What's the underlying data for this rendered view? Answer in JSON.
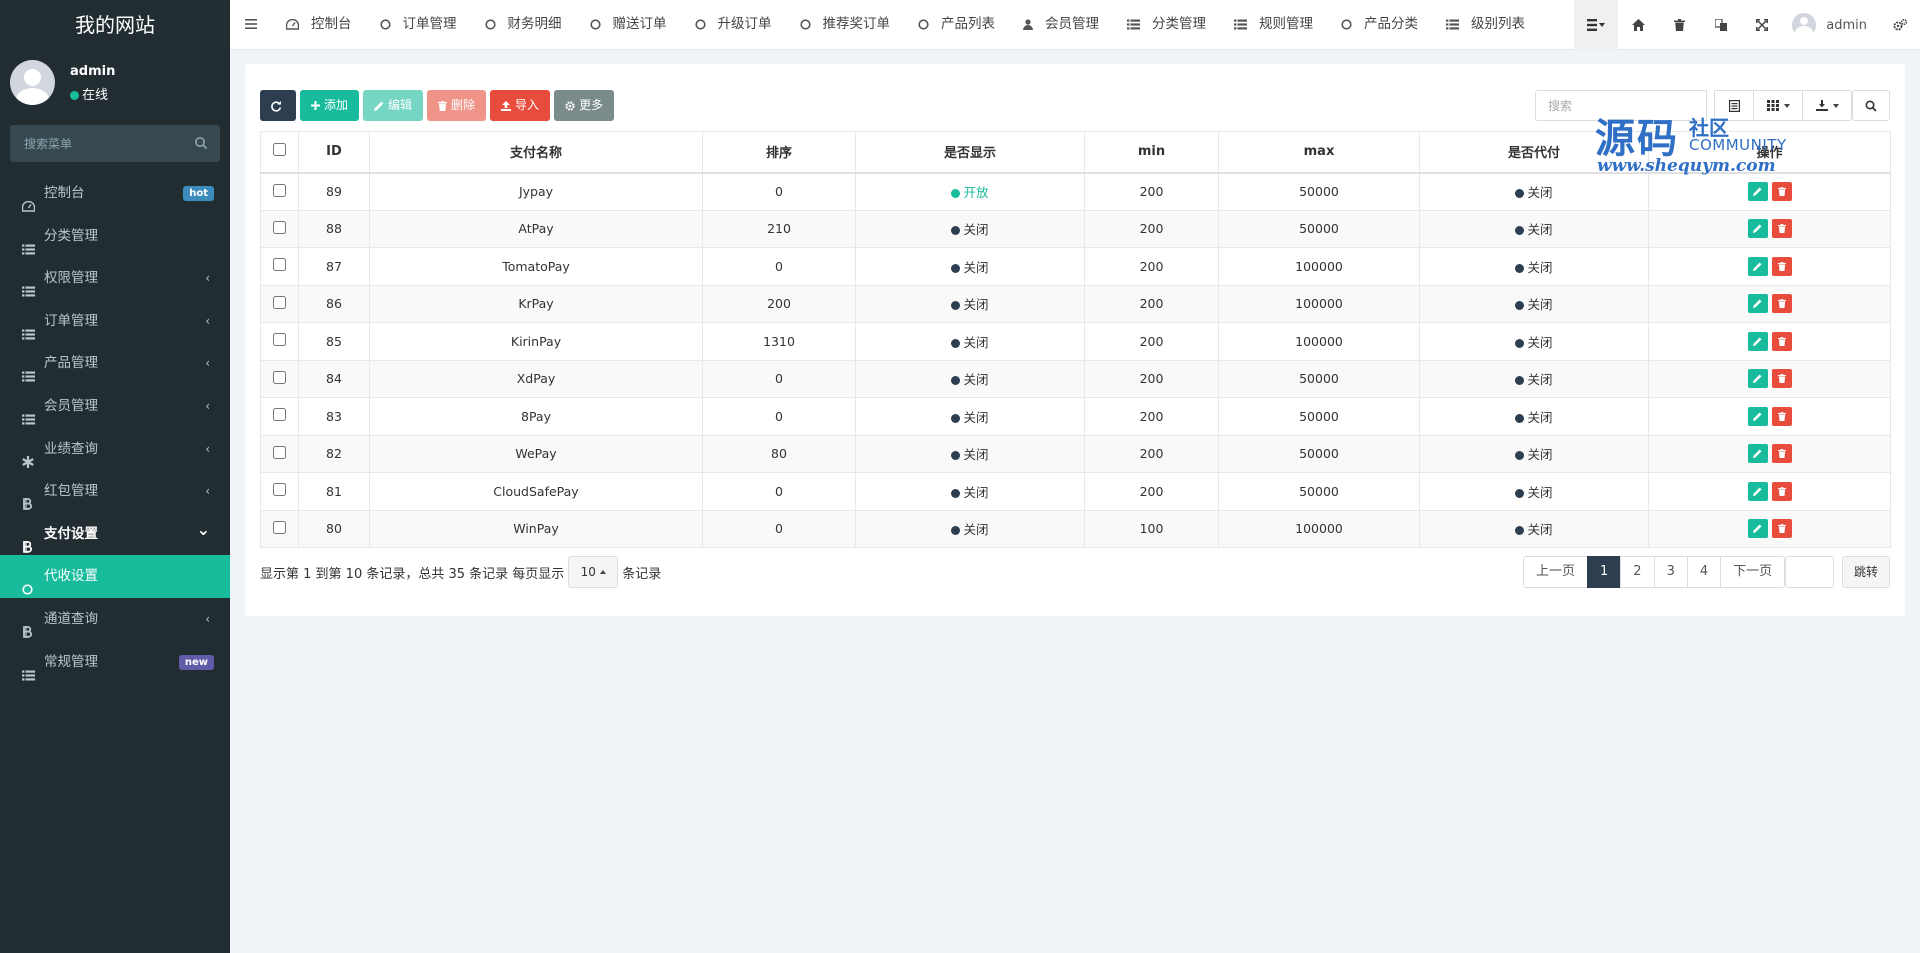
{
  "sidebar": {
    "site_title": "我的网站",
    "user": {
      "name": "admin",
      "status": "在线"
    },
    "search_placeholder": "搜索菜单",
    "items": [
      {
        "label": "控制台",
        "icon": "dashboard-icon",
        "badge": "hot"
      },
      {
        "label": "分类管理",
        "icon": "list-icon"
      },
      {
        "label": "权限管理",
        "icon": "list-icon",
        "arrow": "‹"
      },
      {
        "label": "订单管理",
        "icon": "list-icon",
        "arrow": "‹"
      },
      {
        "label": "产品管理",
        "icon": "list-icon",
        "arrow": "‹"
      },
      {
        "label": "会员管理",
        "icon": "list-icon",
        "arrow": "‹"
      },
      {
        "label": "业绩查询",
        "icon": "asterisk-icon",
        "arrow": "‹"
      },
      {
        "label": "红包管理",
        "icon": "bitcoin-icon",
        "arrow": "‹"
      },
      {
        "label": "支付设置",
        "icon": "bitcoin-icon",
        "arrow": "⌄"
      },
      {
        "label": "代收设置",
        "icon": "circle-icon"
      },
      {
        "label": "通道查询",
        "icon": "bitcoin-icon",
        "arrow": "‹"
      },
      {
        "label": "常规管理",
        "icon": "list-icon",
        "badge": "new"
      }
    ]
  },
  "topnav": {
    "tabs": [
      {
        "label": "控制台",
        "icon": "dashboard-icon"
      },
      {
        "label": "订单管理",
        "icon": "circle-icon"
      },
      {
        "label": "财务明细",
        "icon": "circle-icon"
      },
      {
        "label": "赠送订单",
        "icon": "circle-icon"
      },
      {
        "label": "升级订单",
        "icon": "circle-icon"
      },
      {
        "label": "推荐奖订单",
        "icon": "circle-icon"
      },
      {
        "label": "产品列表",
        "icon": "circle-icon"
      },
      {
        "label": "会员管理",
        "icon": "user-icon"
      },
      {
        "label": "分类管理",
        "icon": "list-icon"
      },
      {
        "label": "规则管理",
        "icon": "list-icon"
      },
      {
        "label": "产品分类",
        "icon": "circle-icon"
      },
      {
        "label": "级别列表",
        "icon": "list-icon"
      }
    ],
    "user_name": "admin"
  },
  "toolbar": {
    "add_label": "添加",
    "edit_label": "编辑",
    "delete_label": "删除",
    "import_label": "导入",
    "more_label": "更多",
    "search_placeholder": "搜索"
  },
  "watermark": {
    "big": "源码",
    "small": "社区",
    "community": "COMMUNITY",
    "url": "www.shequym.com"
  },
  "table": {
    "columns": [
      "ID",
      "支付名称",
      "排序",
      "是否显示",
      "min",
      "max",
      "是否代付",
      "操作"
    ],
    "rows": [
      {
        "id": "89",
        "name": "Jypay",
        "sort": "0",
        "show": "开放",
        "show_open": true,
        "min": "200",
        "max": "50000",
        "payout": "关闭"
      },
      {
        "id": "88",
        "name": "AtPay",
        "sort": "210",
        "show": "关闭",
        "show_open": false,
        "min": "200",
        "max": "50000",
        "payout": "关闭"
      },
      {
        "id": "87",
        "name": "TomatoPay",
        "sort": "0",
        "show": "关闭",
        "show_open": false,
        "min": "200",
        "max": "100000",
        "payout": "关闭"
      },
      {
        "id": "86",
        "name": "KrPay",
        "sort": "200",
        "show": "关闭",
        "show_open": false,
        "min": "200",
        "max": "100000",
        "payout": "关闭"
      },
      {
        "id": "85",
        "name": "KirinPay",
        "sort": "1310",
        "show": "关闭",
        "show_open": false,
        "min": "200",
        "max": "100000",
        "payout": "关闭"
      },
      {
        "id": "84",
        "name": "XdPay",
        "sort": "0",
        "show": "关闭",
        "show_open": false,
        "min": "200",
        "max": "50000",
        "payout": "关闭"
      },
      {
        "id": "83",
        "name": "8Pay",
        "sort": "0",
        "show": "关闭",
        "show_open": false,
        "min": "200",
        "max": "50000",
        "payout": "关闭"
      },
      {
        "id": "82",
        "name": "WePay",
        "sort": "80",
        "show": "关闭",
        "show_open": false,
        "min": "200",
        "max": "50000",
        "payout": "关闭"
      },
      {
        "id": "81",
        "name": "CloudSafePay",
        "sort": "0",
        "show": "关闭",
        "show_open": false,
        "min": "200",
        "max": "50000",
        "payout": "关闭"
      },
      {
        "id": "80",
        "name": "WinPay",
        "sort": "0",
        "show": "关闭",
        "show_open": false,
        "min": "100",
        "max": "100000",
        "payout": "关闭"
      }
    ]
  },
  "footer": {
    "summary_prefix": "显示第 1 到第 10 条记录，总共 35 条记录 每页显示",
    "page_size": "10",
    "summary_suffix": "条记录",
    "prev": "上一页",
    "pages": [
      "1",
      "2",
      "3",
      "4"
    ],
    "current_page": "1",
    "next": "下一页",
    "jump": "跳转"
  },
  "colors": {
    "primary": "#18bc9c",
    "dark": "#2c3e50",
    "danger": "#e74c3c",
    "sidebar": "#222d32"
  }
}
